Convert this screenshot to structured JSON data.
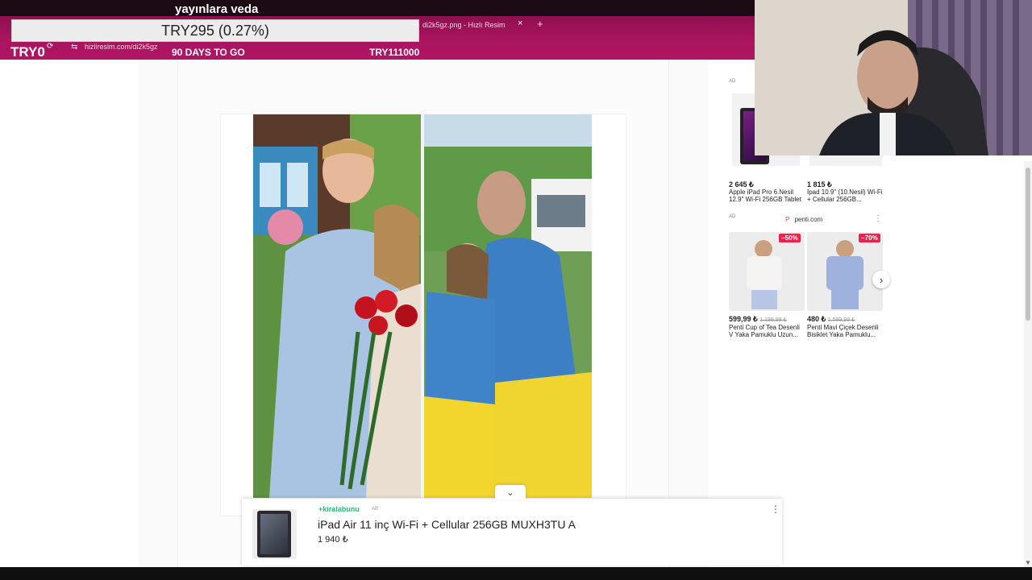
{
  "stream": {
    "title": "yayınlara veda",
    "donation": "TRY295 (0.27%)",
    "counter": "TRY0",
    "days_to_go": "90 DAYS TO GO",
    "goal": "TRY111000"
  },
  "browser": {
    "tab_title": "di2k5gz.png - Hızlı Resim",
    "tab_close": "×",
    "new_tab": "+",
    "url": "hizliresim.com/di2k5gz"
  },
  "ads": {
    "ad_label": "AD",
    "block1": {
      "products": [
        {
          "price": "2 645 ₺",
          "name": "Apple iPad Pro 6.Nesil 12.9\" Wi-Fi 256GB Tablet"
        },
        {
          "price": "1 815 ₺",
          "name": "İpad 10.9\" (10.Nesil) Wi-Fi + Cellular 256GB..."
        }
      ]
    },
    "block2": {
      "advertiser": "penti.com",
      "products": [
        {
          "discount": "−50%",
          "price": "599,99 ₺",
          "old_price": "1.199,99 ₺",
          "name": "Penti Cup of Tea Desenli V Yaka Pamuklu Uzun..."
        },
        {
          "discount": "−70%",
          "price": "480 ₺",
          "old_price": "1.599,99 ₺",
          "name": "Penti Mavi Çiçek Desenli Bisiklet Yaka Pamuklu..."
        }
      ]
    }
  },
  "bottom_ad": {
    "brand": "+kiralabunu",
    "ad_label": "AB",
    "title": "iPad Air 11 inç Wi-Fi + Cellular 256GB MUXH3TU A",
    "price": "1 940 ₺"
  }
}
